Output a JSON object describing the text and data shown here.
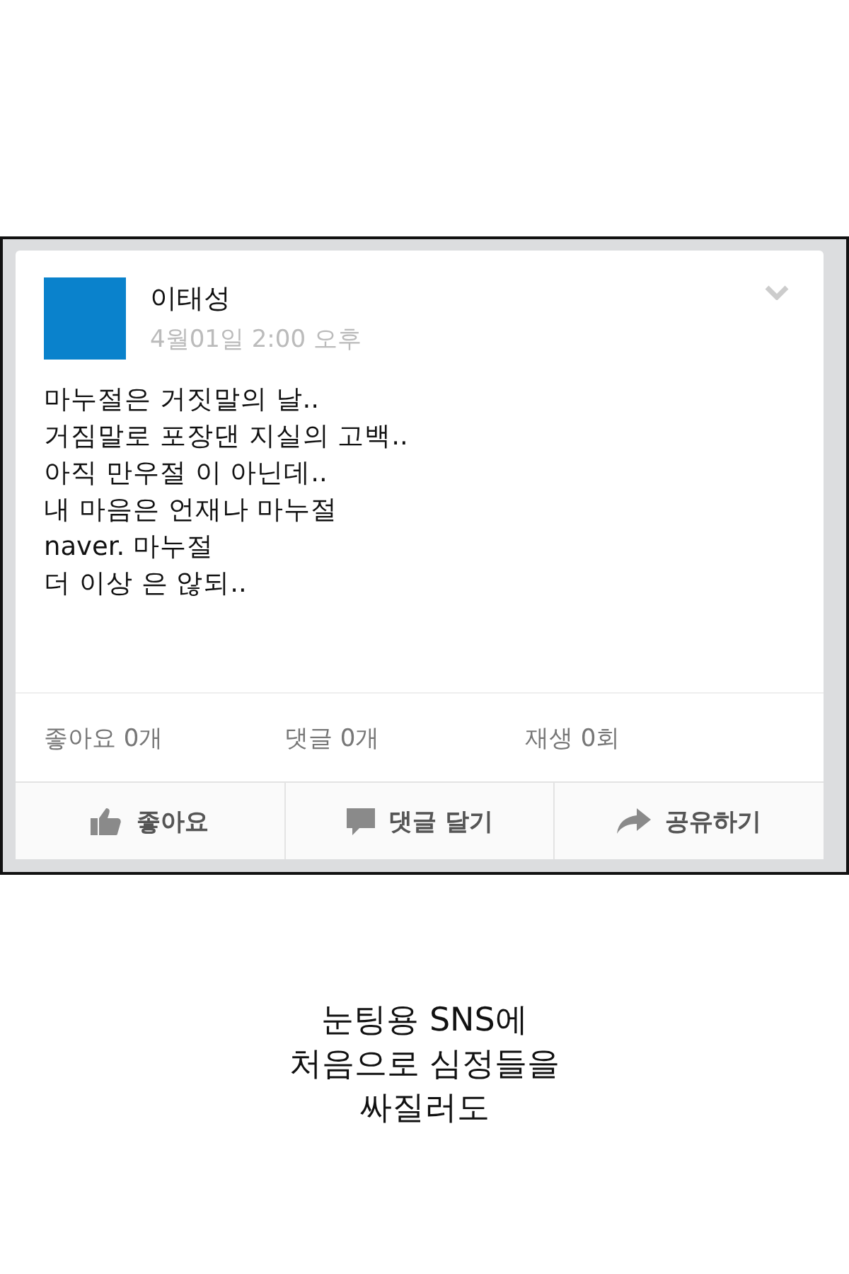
{
  "post": {
    "author": "이태성",
    "time": "4월01일 2:00 오후",
    "body": "마누절은 거짓말의 날..\n거짐말로 포장댄 지실의 고백..\n아직 만우절 이 아닌데..\n내 마음은 언재나 마누절\nnaver. 마누절\n더 이상 은 않되..",
    "stats": [
      "좋아요 0개",
      "댓글 0개",
      "재생 0회"
    ],
    "actions": [
      {
        "kind": "like",
        "label": "좋아요"
      },
      {
        "kind": "comment",
        "label": "댓글 달기"
      },
      {
        "kind": "share",
        "label": "공유하기"
      }
    ]
  },
  "caption": [
    "눈팅용 SNS에",
    "처음으로 심정들을",
    "싸질러도"
  ]
}
